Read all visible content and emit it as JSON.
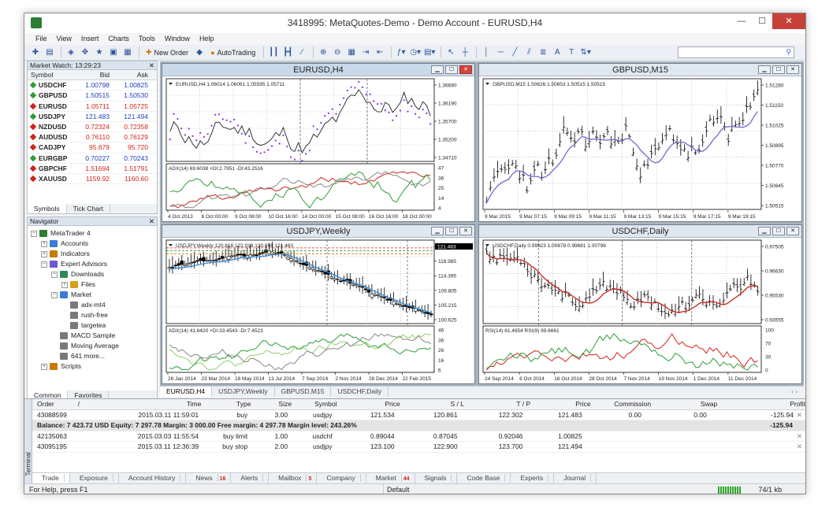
{
  "window": {
    "title": "3418995: MetaQuotes-Demo - Demo Account - EURUSD,H4",
    "minimize": "—",
    "maximize": "☐",
    "close": "✕"
  },
  "menu": [
    "File",
    "View",
    "Insert",
    "Charts",
    "Tools",
    "Window",
    "Help"
  ],
  "toolbar": {
    "new_order": "New Order",
    "autotrading": "AutoTrading"
  },
  "market_watch": {
    "title": "Market Watch: 13:29:23",
    "cols": [
      "Symbol",
      "Bid",
      "Ask"
    ],
    "rows": [
      {
        "s": "USDCHF",
        "b": "1.00798",
        "a": "1.00825",
        "d": "up"
      },
      {
        "s": "GBPUSD",
        "b": "1.50515",
        "a": "1.50530",
        "d": "up"
      },
      {
        "s": "EURUSD",
        "b": "1.05711",
        "a": "1.05725",
        "d": "dn"
      },
      {
        "s": "USDJPY",
        "b": "121.483",
        "a": "121.494",
        "d": "up"
      },
      {
        "s": "NZDUSD",
        "b": "0.72324",
        "a": "0.72358",
        "d": "dn"
      },
      {
        "s": "AUDUSD",
        "b": "0.76110",
        "a": "0.76129",
        "d": "dn"
      },
      {
        "s": "CADJPY",
        "b": "95.679",
        "a": "95.720",
        "d": "dn"
      },
      {
        "s": "EURGBP",
        "b": "0.70227",
        "a": "0.70243",
        "d": "up"
      },
      {
        "s": "GBPCHF",
        "b": "1.51694",
        "a": "1.51791",
        "d": "dn"
      },
      {
        "s": "XAUUSD",
        "b": "1159.92",
        "a": "1160.60",
        "d": "dn"
      }
    ],
    "tabs": [
      "Symbols",
      "Tick Chart"
    ]
  },
  "navigator": {
    "title": "Navigator",
    "items": [
      {
        "l": "MetaTrader 4",
        "lvl": 0,
        "c": "#2e7d32",
        "pm": "−"
      },
      {
        "l": "Accounts",
        "lvl": 1,
        "c": "#3a7bd5",
        "pm": "+"
      },
      {
        "l": "Indicators",
        "lvl": 1,
        "c": "#c77a00",
        "pm": "+"
      },
      {
        "l": "Expert Advisors",
        "lvl": 1,
        "c": "#6a5acd",
        "pm": "−"
      },
      {
        "l": "Downloads",
        "lvl": 2,
        "c": "#2e8b57",
        "pm": "−"
      },
      {
        "l": "Files",
        "lvl": 3,
        "c": "#d4a017",
        "pm": "+"
      },
      {
        "l": "Market",
        "lvl": 2,
        "c": "#3a7bd5",
        "pm": "−"
      },
      {
        "l": "adx-mt4",
        "lvl": 3,
        "c": "#7a7a7a",
        "pm": ""
      },
      {
        "l": "rush-free",
        "lvl": 3,
        "c": "#7a7a7a",
        "pm": ""
      },
      {
        "l": "targetea",
        "lvl": 3,
        "c": "#7a7a7a",
        "pm": ""
      },
      {
        "l": "MACD Sample",
        "lvl": 2,
        "c": "#7a7a7a",
        "pm": ""
      },
      {
        "l": "Moving Average",
        "lvl": 2,
        "c": "#7a7a7a",
        "pm": ""
      },
      {
        "l": "641 more...",
        "lvl": 2,
        "c": "#7a7a7a",
        "pm": ""
      },
      {
        "l": "Scripts",
        "lvl": 1,
        "c": "#c77a00",
        "pm": "+"
      }
    ],
    "tabs": [
      "Common",
      "Favorites"
    ]
  },
  "charts": [
    {
      "title": "EURUSD,H4",
      "info": "EURUSD,H4  1.06014 1.06061 1.05595 1.05711",
      "ind": "ADX(14) 69.6038 +DI:2.7951 -DI:43.2516",
      "prices": [
        "1.36690",
        "1.36190",
        "1.35700",
        "1.35200",
        "1.34710"
      ],
      "ind_scale": [
        "47",
        "36",
        "25",
        "14",
        "4"
      ],
      "dates": [
        "4 Oct 2013",
        "8 Oct 00:00",
        "9 Oct 08:00",
        "10 Oct 16:00",
        "14 Oct 00:00",
        "15 Oct 08:00",
        "16 Oct 16:00",
        "18 Oct 00:00"
      ]
    },
    {
      "title": "GBPUSD,M15",
      "info": "GBPUSD,M15  1.50626 1.50653 1.50515 1.50515",
      "prices": [
        "1.51280",
        "1.51150",
        "1.51025",
        "1.50895",
        "1.50770",
        "1.50645",
        "1.50515"
      ],
      "dates": [
        "9 Mar 2015",
        "9 Mar 07:15",
        "9 Mar 09:15",
        "9 Mar 11:15",
        "9 Mar 13:15",
        "9 Mar 15:15",
        "9 Mar 17:15",
        "9 Mar 19:15"
      ]
    },
    {
      "title": "USDJPY,Weekly",
      "info": "USDJPY,Weekly  120.816 122.018 120.608 121.483",
      "ind": "ADX(14) 41.6420 +DI:33.4543 -DI:7.4523",
      "prices": [
        "121.483",
        "118.985",
        "114.395",
        "109.805",
        "105.215",
        "100.625"
      ],
      "ind_scale": [
        "46",
        "36",
        "26",
        "16",
        "6"
      ],
      "dates": [
        "26 Jan 2014",
        "23 Mar 2014",
        "18 May 2014",
        "13 Jul 2014",
        "7 Sep 2014",
        "2 Nov 2014",
        "28 Dec 2014",
        "22 Feb 2015"
      ]
    },
    {
      "title": "USDCHF,Daily",
      "info": "USDCHF,Daily  0.99923 1.00878 0.99681 1.00798",
      "ind": "RSI(14) 61.4954  RSI(9) 99.6661",
      "prices": [
        "0.97505",
        "0.96630",
        "0.95530",
        "0.93555"
      ],
      "ind_scale": [
        "100",
        "70",
        "30",
        "0"
      ],
      "dates": [
        "24 Sep 2014",
        "6 Oct 2014",
        "16 Oct 2014",
        "28 Oct 2014",
        "7 Nov 2014",
        "19 Nov 2014",
        "1 Dec 2014",
        "11 Dec 2014"
      ]
    }
  ],
  "chart_tabs": [
    "EURUSD,H4",
    "USDJPY,Weekly",
    "GBPUSD,M15",
    "USDCHF,Daily"
  ],
  "terminal": {
    "label": "Terminal",
    "cols": [
      "Order",
      "/",
      "Time",
      "Type",
      "Size",
      "Symbol",
      "Price",
      "S / L",
      "T / P",
      "Price",
      "Commission",
      "Swap",
      "Profit"
    ],
    "rows": [
      [
        "43088599",
        "2015.03.11 11:59:01",
        "buy",
        "3.00",
        "usdjpy",
        "121.534",
        "120.861",
        "122.302",
        "121.483",
        "0.00",
        "0.00",
        "-125.94"
      ]
    ],
    "balance": "Balance: 7 423.72 USD  Equity: 7 297.78  Margin: 3 000.00  Free margin: 4 297.78  Margin level: 243.26%",
    "balance_profit": "-125.94",
    "pending": [
      [
        "42135063",
        "2015.03.03 11:55:54",
        "buy limit",
        "1.00",
        "usdchf",
        "0.89044",
        "0.87045",
        "0.92046",
        "1.00825"
      ],
      [
        "43095195",
        "2015.03.11 12:36:39",
        "buy stop",
        "2.00",
        "usdjpy",
        "123.100",
        "122.900",
        "123.700",
        "121.494"
      ]
    ],
    "tabs": [
      {
        "l": "Trade",
        "n": ""
      },
      {
        "l": "Exposure",
        "n": ""
      },
      {
        "l": "Account History",
        "n": ""
      },
      {
        "l": "News",
        "n": "16"
      },
      {
        "l": "Alerts",
        "n": ""
      },
      {
        "l": "Mailbox",
        "n": "5"
      },
      {
        "l": "Company",
        "n": ""
      },
      {
        "l": "Market",
        "n": "44"
      },
      {
        "l": "Signals",
        "n": ""
      },
      {
        "l": "Code Base",
        "n": ""
      },
      {
        "l": "Experts",
        "n": ""
      },
      {
        "l": "Journal",
        "n": ""
      }
    ]
  },
  "status": {
    "help": "For Help, press F1",
    "profile": "Default",
    "traffic": "74/1 kb"
  }
}
